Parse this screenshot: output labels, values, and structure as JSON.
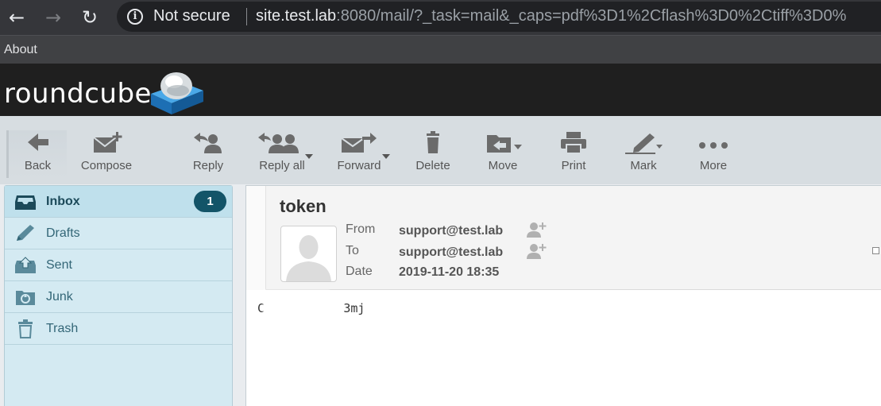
{
  "browser": {
    "security_label": "Not secure",
    "url_host": "site.test.lab",
    "url_rest": ":8080/mail/?_task=mail&_caps=pdf%3D1%2Cflash%3D0%2Ctiff%3D0%",
    "icons": {
      "back": "arrow-left-icon",
      "forward": "arrow-right-icon",
      "reload": "reload-icon",
      "info": "info-icon"
    }
  },
  "bookmarks": {
    "about": "About"
  },
  "app": {
    "logo_text": "roundcube"
  },
  "toolbar": {
    "back": "Back",
    "compose": "Compose",
    "reply": "Reply",
    "reply_all": "Reply all",
    "forward": "Forward",
    "delete": "Delete",
    "move": "Move",
    "print": "Print",
    "mark": "Mark",
    "more": "More"
  },
  "folders": [
    {
      "name": "Inbox",
      "icon": "inbox-icon",
      "unread": "1",
      "selected": true
    },
    {
      "name": "Drafts",
      "icon": "pencil-icon"
    },
    {
      "name": "Sent",
      "icon": "sent-icon"
    },
    {
      "name": "Junk",
      "icon": "junk-icon"
    },
    {
      "name": "Trash",
      "icon": "trash-icon"
    }
  ],
  "message": {
    "subject": "token",
    "from_label": "From",
    "from": "support@test.lab",
    "to_label": "To",
    "to": "support@test.lab",
    "date_label": "Date",
    "date": "2019-11-20 18:35",
    "body": "C           3mj"
  },
  "colors": {
    "header_bg": "#1f1f1f",
    "toolbar_bg": "#d7dde1",
    "folder_bg": "#d4eaf2",
    "folder_selected_bg": "#bfe0ec",
    "badge_bg": "#135468",
    "logo_blue": "#2c8fd6"
  }
}
